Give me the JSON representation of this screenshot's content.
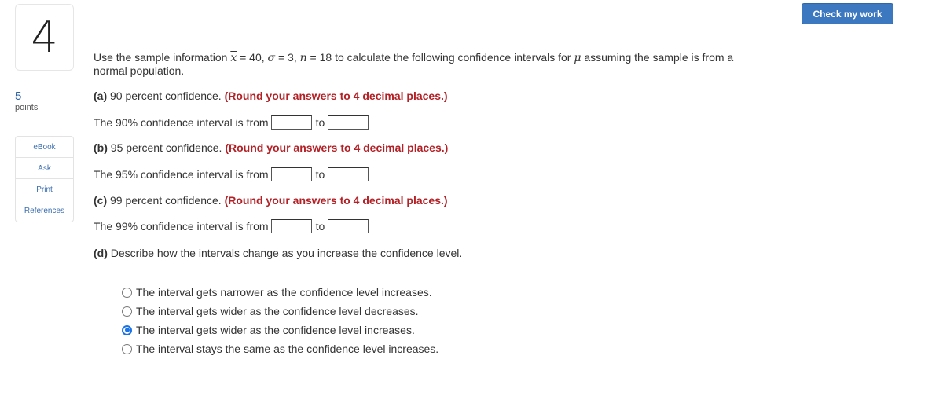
{
  "header": {
    "check_button_label": "Check my work"
  },
  "question": {
    "number": "4",
    "points_value": "5",
    "points_label": "points"
  },
  "side_menu": {
    "items": [
      {
        "label": "eBook"
      },
      {
        "label": "Ask"
      },
      {
        "label": "Print"
      },
      {
        "label": "References"
      }
    ]
  },
  "prompt": {
    "prefix": "Use the sample information ",
    "xbar_symbol": "x",
    "xbar_value": " = 40, ",
    "sigma_symbol": "σ",
    "sigma_value": " = 3, ",
    "n_symbol": "n",
    "n_value": " = 18 to calculate the following confidence intervals for ",
    "mu_symbol": "μ",
    "suffix": " assuming the sample is from a normal population."
  },
  "parts": [
    {
      "letter": "(a)",
      "text": " 90 percent confidence. ",
      "instruction": "(Round your answers to 4 decimal places.)",
      "interval_label": "The 90% confidence interval is from",
      "to_label": "to",
      "lower_value": "",
      "upper_value": ""
    },
    {
      "letter": "(b)",
      "text": " 95 percent confidence. ",
      "instruction": "(Round your answers to 4 decimal places.)",
      "interval_label": "The 95% confidence interval is from",
      "to_label": "to",
      "lower_value": "",
      "upper_value": ""
    },
    {
      "letter": "(c)",
      "text": " 99 percent confidence. ",
      "instruction": "(Round your answers to 4 decimal places.)",
      "interval_label": "The 99% confidence interval is from",
      "to_label": "to",
      "lower_value": "",
      "upper_value": ""
    }
  ],
  "part_d": {
    "letter": "(d)",
    "text": " Describe how the intervals change as you increase the confidence level.",
    "options": [
      {
        "label": "The interval gets narrower as the confidence level increases.",
        "selected": false
      },
      {
        "label": "The interval gets wider as the confidence level decreases.",
        "selected": false
      },
      {
        "label": "The interval gets wider as the confidence level increases.",
        "selected": true
      },
      {
        "label": "The interval stays the same as the confidence level increases.",
        "selected": false
      }
    ]
  },
  "colors": {
    "accent_blue": "#3b78c0",
    "instruction_red": "#b32025",
    "radio_selected": "#1a73e8"
  }
}
